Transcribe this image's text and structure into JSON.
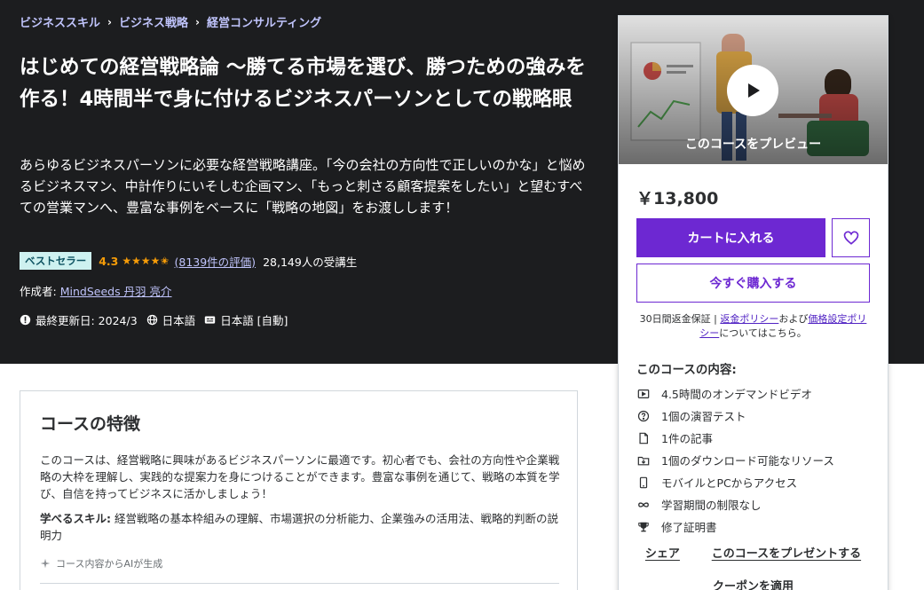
{
  "breadcrumb": [
    "ビジネススキル",
    "ビジネス戦略",
    "経営コンサルティング"
  ],
  "course": {
    "title": "はじめての経営戦略論 ～勝てる市場を選び、勝つための強みを作る！4時間半で身に付けるビジネスパーソンとしての戦略眼",
    "subtitle": "あらゆるビジネスパーソンに必要な経営戦略講座。「今の会社の方向性で正しいのかな」と悩めるビジネスマン、中計作りにいそしむ企画マン、「もっと刺さる顧客提案をしたい」と望むすべての営業マンへ、豊富な事例をベースに「戦略の地図」をお渡しします！",
    "badge": "ベストセラー",
    "rating": "4.3",
    "rating_value": 4.3,
    "stars": "★★★★✬",
    "reviews": "(8139件の評価)",
    "students": "28,149人の受講生",
    "author_label": "作成者:",
    "author": "MindSeeds 丹羽 亮介",
    "updated": "最終更新日: 2024/3",
    "language": "日本語",
    "captions": "日本語 [自動]"
  },
  "card": {
    "preview_label": "このコースをプレビュー",
    "price": "￥13,800",
    "cart_button": "カートに入れる",
    "buy_button": "今すぐ購入する",
    "guarantee_text": "30日間返金保証 |",
    "refund_policy": "返金ポリシー",
    "and": "および",
    "pricing_policy": "価格設定ポリシー",
    "guarantee_tail": "についてはこちら。",
    "includes_title": "このコースの内容:",
    "includes": [
      {
        "icon": "video-icon",
        "label": "4.5時間のオンデマンドビデオ"
      },
      {
        "icon": "quiz-icon",
        "label": "1個の演習テスト"
      },
      {
        "icon": "article-icon",
        "label": "1件の記事"
      },
      {
        "icon": "download-icon",
        "label": "1個のダウンロード可能なリソース"
      },
      {
        "icon": "mobile-icon",
        "label": "モバイルとPCからアクセス"
      },
      {
        "icon": "infinity-icon",
        "label": "学習期間の制限なし"
      },
      {
        "icon": "trophy-icon",
        "label": "修了証明書"
      }
    ],
    "share": "シェア",
    "gift": "このコースをプレゼントする",
    "coupon": "クーポンを適用"
  },
  "features": {
    "title": "コースの特徴",
    "body": "このコースは、経営戦略に興味があるビジネスパーソンに最適です。初心者でも、会社の方向性や企業戦略の大枠を理解し、実践的な提案力を身につけることができます。豊富な事例を通じて、戦略の本質を学び、自信を持ってビジネスに活かしましょう！",
    "skills_label": "学べるスキル:",
    "skills": " 経営戦略の基本枠組みの理解、市場選択の分析能力、企業強みの活用法、戦略的判断の説明力",
    "ai_note": "コース内容からAIが生成"
  },
  "colors": {
    "hero_bg": "#1c1d1f",
    "accent": "#6d28d2",
    "link": "#c0c4fc",
    "star": "#f69c08",
    "badge_bg": "#cef1f0"
  }
}
